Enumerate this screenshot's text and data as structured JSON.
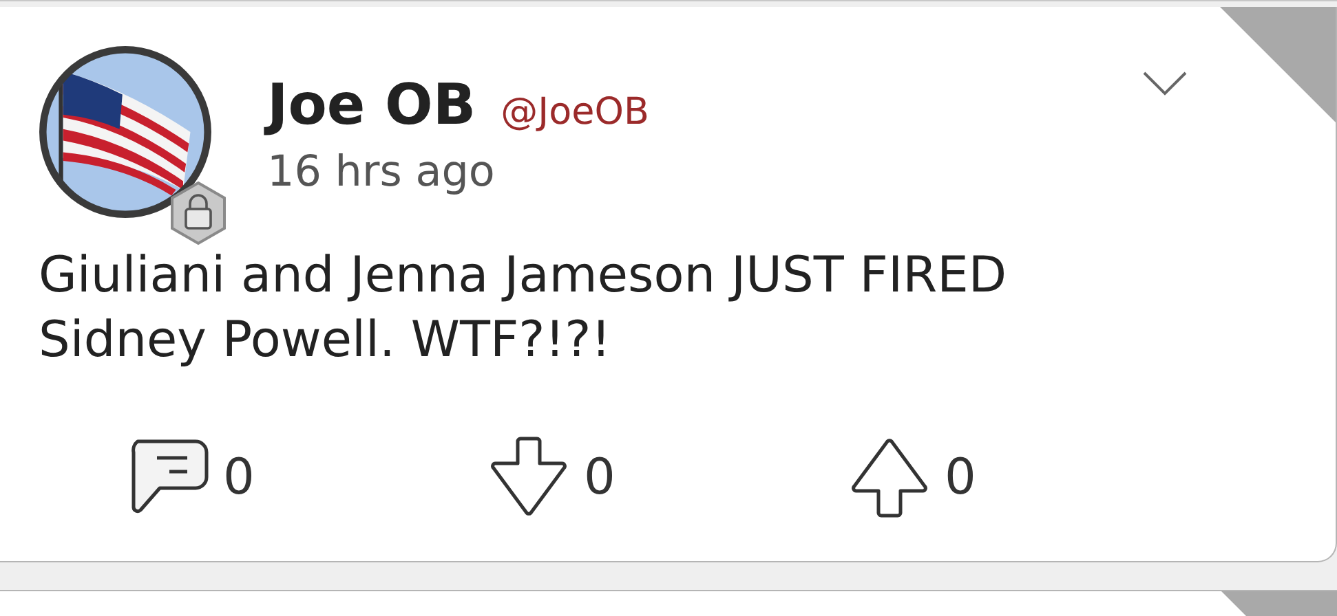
{
  "post": {
    "author": {
      "name": "Joe OB",
      "handle": "@JoeOB"
    },
    "time": "16 hrs ago",
    "text": "Giuliani and Jenna Jameson JUST FIRED Sidney Powell. WTF?!?!",
    "actions": [
      {
        "kind": "comment",
        "count": "0"
      },
      {
        "kind": "downvote",
        "count": "0"
      },
      {
        "kind": "upvote",
        "count": "0"
      }
    ]
  }
}
